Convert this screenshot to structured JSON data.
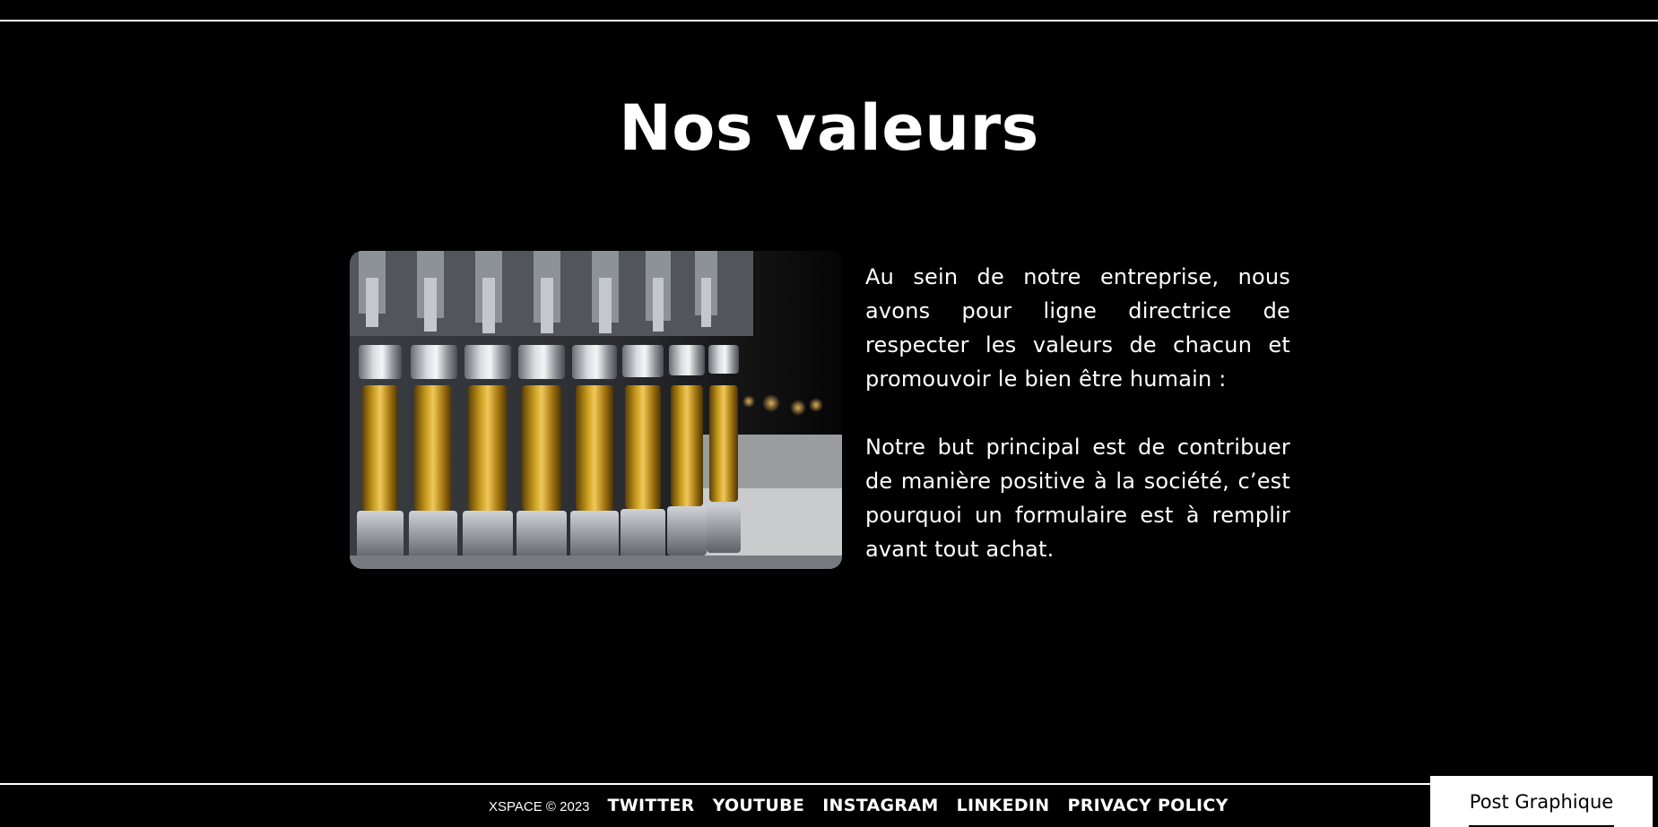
{
  "section": {
    "title": "Nos valeurs",
    "paragraphs": [
      "Au sein de notre entreprise, nous avons pour ligne directrice de respecter les valeurs de chacun et promouvoir le bien être humain :",
      "Notre but principal est de contribuer de manière positive à la société, c’est pourquoi un formulaire est à remplir avant tout achat."
    ]
  },
  "footer": {
    "copyright": "XSPACE © 2023",
    "links": [
      "TWITTER",
      "YOUTUBE",
      "INSTAGRAM",
      "LINKEDIN",
      "PRIVACY POLICY"
    ]
  },
  "floating_button": {
    "label": "Post Graphique"
  },
  "colors": {
    "background": "#000000",
    "text": "#ffffff",
    "button_background": "#ffffff",
    "button_text": "#000000"
  }
}
